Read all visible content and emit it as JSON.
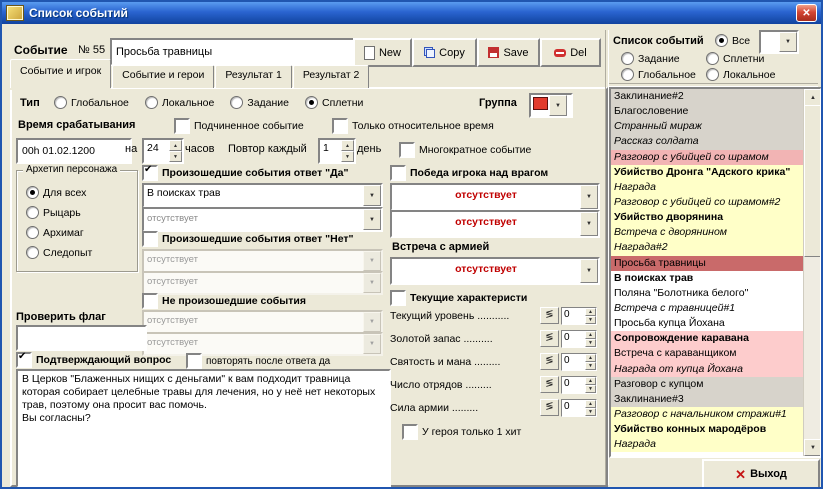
{
  "win": {
    "title": "Список событий"
  },
  "header": {
    "event_label": "Событие",
    "event_number": "№ 55",
    "event_name": "Просьба травницы",
    "btn_new": "New",
    "btn_copy": "Copy",
    "btn_save": "Save",
    "btn_del": "Del"
  },
  "tabs": [
    {
      "label": "Событие и игрок",
      "active": true
    },
    {
      "label": "Событие и герои",
      "active": false
    },
    {
      "label": "Результат 1",
      "active": false
    },
    {
      "label": "Результат 2",
      "active": false
    }
  ],
  "type": {
    "label": "Тип",
    "options": [
      {
        "label": "Глобальное",
        "checked": false
      },
      {
        "label": "Локальное",
        "checked": false
      },
      {
        "label": "Задание",
        "checked": false
      },
      {
        "label": "Сплетни",
        "checked": true
      }
    ],
    "group_label": "Группа"
  },
  "timing": {
    "label": "Время срабатывания",
    "subordinate": "Подчиненное событие",
    "subordinate_checked": false,
    "relative": "Только относительное время",
    "relative_checked": false,
    "datetime": "00h 01.02.1200",
    "na": "на",
    "hours_value": "24",
    "hours_unit": "часов",
    "repeat_label": "Повтор каждый",
    "repeat_value": "1",
    "repeat_unit": "день",
    "multiple": "Многократное событие",
    "multiple_checked": false
  },
  "archetype": {
    "legend": "Архетип персонажа",
    "options": [
      {
        "label": "Для всех",
        "checked": true
      },
      {
        "label": "Рыцарь",
        "checked": false
      },
      {
        "label": "Архимаг",
        "checked": false
      },
      {
        "label": "Следопыт",
        "checked": false
      }
    ]
  },
  "cond": {
    "yes_label": "Произошедшие события ответ \"Да\"",
    "yes_checked": true,
    "yes_combo1": "В поисках трав",
    "yes_combo2": "отсутствует",
    "no_label": "Произошедшие события ответ \"Нет\"",
    "no_checked": false,
    "no_combo1": "отсутствует",
    "no_combo2": "отсутствует",
    "nh_label": "Не произошедшие события",
    "nh_checked": false,
    "nh_combo1": "отсутствует",
    "nh_combo2": "отсутствует",
    "flag_label": "Проверить флаг",
    "flag_value": ""
  },
  "confirm": {
    "label": "Подтверждающий вопрос",
    "checked": true,
    "repeat_label": "повторять после ответа да",
    "repeat_checked": false,
    "text": "В Церков \"Блаженных нищих с деньгами\" к вам подходит травница которая собирает целебные травы для лечения, но у неё нет некоторых трав, поэтому она просит вас помочь.\nВы согласны?"
  },
  "victory": {
    "label": "Победа игрока над врагом",
    "checked": false,
    "combo1": "отсутствует",
    "combo2": "отсутствует"
  },
  "army": {
    "label": "Встреча с армией",
    "combo": "отсутствует"
  },
  "chars": {
    "label": "Текущие характеристи",
    "checked": false,
    "rows": [
      {
        "label": "Текущий уровень ...........",
        "value": "0"
      },
      {
        "label": "Золотой запас ..........",
        "value": "0"
      },
      {
        "label": "Святость и мана .........",
        "value": "0"
      },
      {
        "label": "Число отрядов .........",
        "value": "0"
      },
      {
        "label": "Сила армии .........",
        "value": "0"
      }
    ],
    "one_hit_label": "У героя только 1 хит",
    "one_hit_checked": false
  },
  "panel": {
    "title": "Список событий",
    "filters": {
      "all": {
        "label": "Все",
        "checked": true
      },
      "quest": {
        "label": "Задание",
        "checked": false
      },
      "gossip": {
        "label": "Сплетни",
        "checked": false
      },
      "global": {
        "label": "Глобальное",
        "checked": false
      },
      "local": {
        "label": "Локальное",
        "checked": false
      }
    },
    "items": [
      {
        "label": "Заклинание#2",
        "bg": "gray",
        "emphasis": "normal"
      },
      {
        "label": "Благословение",
        "bg": "gray",
        "emphasis": "normal"
      },
      {
        "label": "Странный мираж",
        "bg": "gray",
        "emphasis": "italic"
      },
      {
        "label": "Рассказ солдата",
        "bg": "gray",
        "emphasis": "italic"
      },
      {
        "label": "Разговор с убийцей со шрамом",
        "bg": "pink",
        "emphasis": "italic"
      },
      {
        "label": "Убийство Дронга \"Адского крика\"",
        "bg": "yellow",
        "emphasis": "bold"
      },
      {
        "label": "Награда",
        "bg": "yellow",
        "emphasis": "italic"
      },
      {
        "label": "Разговор с убийцей со шрамом#2",
        "bg": "yellow",
        "emphasis": "italic"
      },
      {
        "label": "Убийство дворянина",
        "bg": "yellow",
        "emphasis": "bold"
      },
      {
        "label": "Встреча с  дворянином",
        "bg": "yellow",
        "emphasis": "italic"
      },
      {
        "label": "Награда#2",
        "bg": "yellow",
        "emphasis": "italic"
      },
      {
        "label": "Просьба травницы",
        "bg": "selected",
        "emphasis": "normal"
      },
      {
        "label": "В поисках трав",
        "bg": "white",
        "emphasis": "bold"
      },
      {
        "label": "Поляна \"Болотника белого\"",
        "bg": "white",
        "emphasis": "normal"
      },
      {
        "label": "Встреча с травницей#1",
        "bg": "white",
        "emphasis": "italic"
      },
      {
        "label": "Просьба купца Йохана",
        "bg": "white",
        "emphasis": "normal"
      },
      {
        "label": "Сопровождение каравана",
        "bg": "rose",
        "emphasis": "bold"
      },
      {
        "label": "Встреча с караванщиком",
        "bg": "rose",
        "emphasis": "normal"
      },
      {
        "label": "Награда от купца Йохана",
        "bg": "rose",
        "emphasis": "italic"
      },
      {
        "label": "Разговор с купцом",
        "bg": "gray",
        "emphasis": "normal"
      },
      {
        "label": "Заклинание#3",
        "bg": "gray",
        "emphasis": "normal"
      },
      {
        "label": "Разговор с начальником стражи#1",
        "bg": "yellow",
        "emphasis": "italic"
      },
      {
        "label": "Убийство конных мародёров",
        "bg": "yellow",
        "emphasis": "bold"
      },
      {
        "label": "Награда",
        "bg": "yellow",
        "emphasis": "italic"
      }
    ],
    "exit_label": "Выход"
  },
  "colors": {
    "titlebar_blue": "#2a64d0",
    "dialog_bg": "#ece9d8",
    "combo_alert_text": "#c00000",
    "group_swatch": "#e23b2e",
    "list_gray": "#d7d3cb",
    "list_yellow": "#ffffc8",
    "list_pink": "#f2b4b4",
    "list_rose": "#fdcccc",
    "list_selected": "#c96a6a"
  }
}
